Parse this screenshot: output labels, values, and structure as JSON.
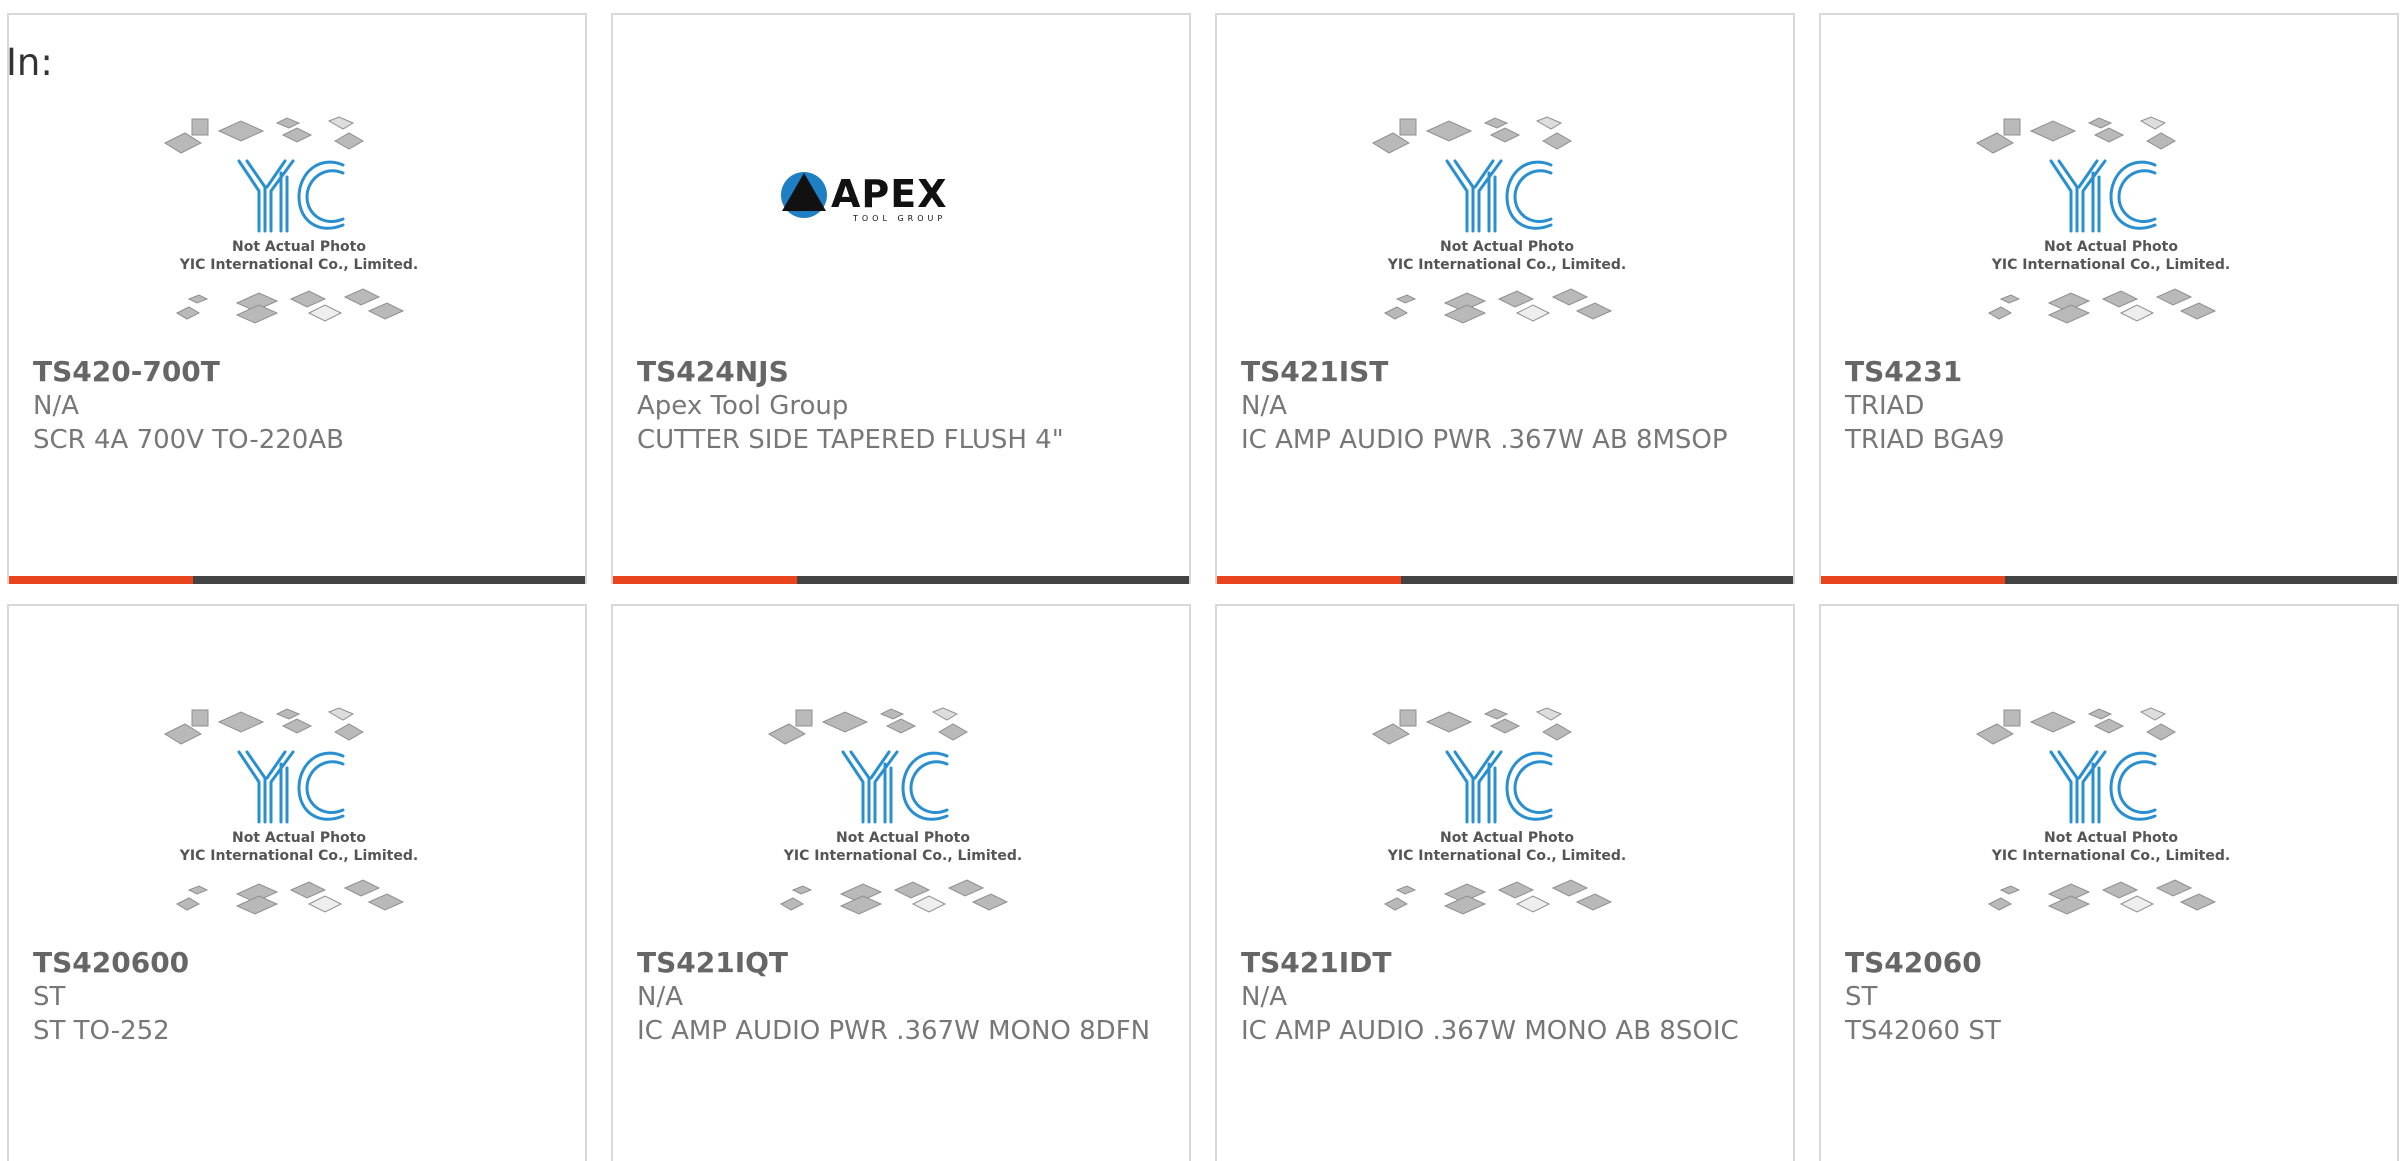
{
  "filter_label": "In:",
  "placeholder": {
    "caption_line1": "Not Actual Photo",
    "caption_line2": "YIC International Co., Limited."
  },
  "apex_logo": {
    "name": "APEX",
    "tagline": "TOOL GROUP"
  },
  "colors": {
    "accent": "#e8451e",
    "bar_track": "#444444",
    "card_border": "#d9d9d9",
    "logo_blue": "#2a8fd0"
  },
  "card_bar_progress": 0.32,
  "products": [
    {
      "part_number": "TS420-700T",
      "manufacturer": "N/A",
      "description": "SCR 4A 700V TO-220AB",
      "image": "yic-placeholder"
    },
    {
      "part_number": "TS424NJS",
      "manufacturer": "Apex Tool Group",
      "description": "CUTTER SIDE TAPERED FLUSH 4\"",
      "image": "apex-logo"
    },
    {
      "part_number": "TS421IST",
      "manufacturer": "N/A",
      "description": "IC AMP AUDIO PWR .367W AB 8MSOP",
      "image": "yic-placeholder"
    },
    {
      "part_number": "TS4231",
      "manufacturer": "TRIAD",
      "description": "TRIAD BGA9",
      "image": "yic-placeholder"
    },
    {
      "part_number": "TS420600",
      "manufacturer": "ST",
      "description": "ST TO-252",
      "image": "yic-placeholder"
    },
    {
      "part_number": "TS421IQT",
      "manufacturer": "N/A",
      "description": "IC AMP AUDIO PWR .367W MONO 8DFN",
      "image": "yic-placeholder"
    },
    {
      "part_number": "TS421IDT",
      "manufacturer": "N/A",
      "description": "IC AMP AUDIO .367W MONO AB 8SOIC",
      "image": "yic-placeholder"
    },
    {
      "part_number": "TS42060",
      "manufacturer": "ST",
      "description": "TS42060 ST",
      "image": "yic-placeholder"
    }
  ]
}
